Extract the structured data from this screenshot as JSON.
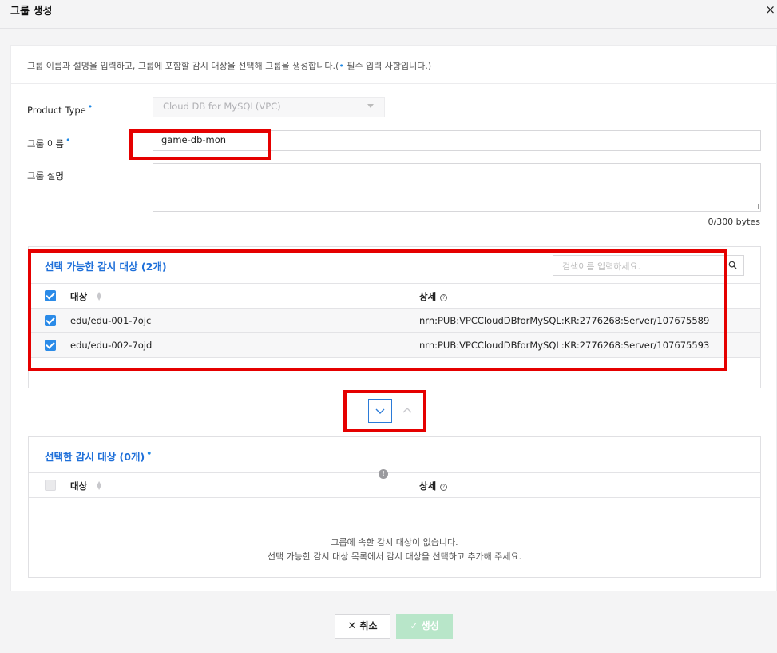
{
  "dialog": {
    "title": "그룹 생성",
    "close_symbol": "×"
  },
  "form": {
    "description_prefix": "그룹 이름과 설명을 입력하고, 그룹에 포함할 감시 대상을 선택해 그룹을 생성합니다.(",
    "description_dot": "•",
    "description_suffix": " 필수 입력 사항입니다.)",
    "product_type_label": "Product Type",
    "product_type_value": "Cloud DB for MySQL(VPC)",
    "group_name_label": "그룹 이름",
    "group_name_value": "game-db-mon",
    "group_desc_label": "그룹 설명",
    "byte_counter": "0/300 bytes",
    "required_mark": "•"
  },
  "available": {
    "title": "선택 가능한 감시 대상 (2개)",
    "search_placeholder": "검색이름 입력하세요.",
    "col_target": "대상",
    "col_detail": "상세",
    "rows": [
      {
        "target": "edu/edu-001-7ojc",
        "detail": "nrn:PUB:VPCCloudDBforMySQL:KR:2776268:Server/107675589",
        "checked": true
      },
      {
        "target": "edu/edu-002-7ojd",
        "detail": "nrn:PUB:VPCCloudDBforMySQL:KR:2776268:Server/107675593",
        "checked": true
      }
    ]
  },
  "selected": {
    "title": "선택한 감시 대상 (0개)",
    "col_target": "대상",
    "col_detail": "상세",
    "empty_line1": "그룹에 속한 감시 대상이 없습니다.",
    "empty_line2": "선택 가능한 감시 대상 목록에서 감시 대상을 선택하고 추가해 주세요."
  },
  "actions": {
    "cancel_label": "취소",
    "create_label": "생성"
  },
  "colors": {
    "accent": "#1e6fd9",
    "checkbox": "#2b8be8",
    "required_dot": "#1e88e5",
    "create_disabled": "#b8e6c9",
    "highlight": "#e50000"
  }
}
